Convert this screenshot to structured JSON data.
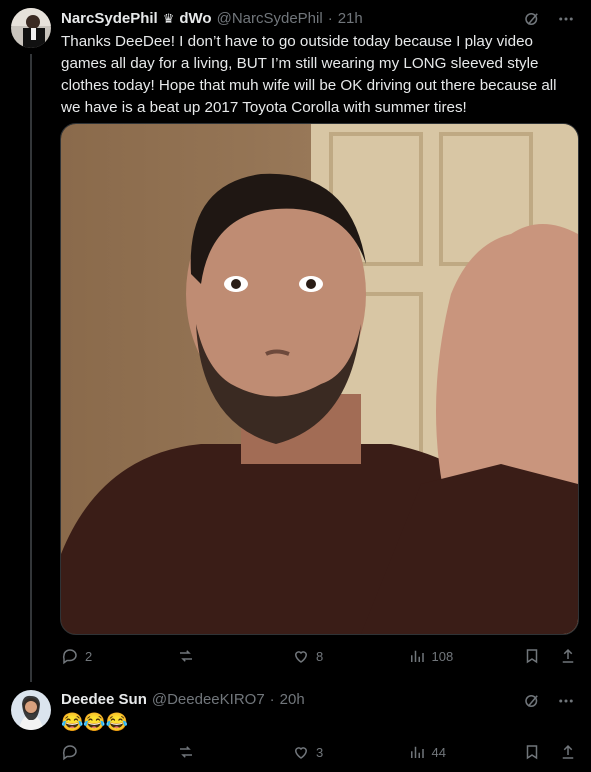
{
  "tweet1": {
    "name": "NarcSydePhil",
    "crown": "♛",
    "name_suffix": "dWo",
    "handle": "@NarcSydePhil",
    "dot": "·",
    "time": "21h",
    "text": "Thanks DeeDee! I don’t have to go outside today because I play video games all day for a living, BUT I’m still wearing my LONG sleeved style clothes today! Hope that muh wife will be OK driving out there because all we have is a beat up 2017 Toyota Corolla with summer tires!",
    "actions": {
      "reply_count": "2",
      "retweet_count": "",
      "like_count": "8",
      "views_count": "108"
    }
  },
  "tweet2": {
    "name": "Deedee Sun",
    "handle": "@DeedeeKIRO7",
    "dot": "·",
    "time": "20h",
    "text": "😂😂😂",
    "actions": {
      "reply_count": "",
      "retweet_count": "",
      "like_count": "3",
      "views_count": "44"
    }
  },
  "icons": {
    "grok": "grok-slash-icon",
    "more": "more-dots-icon",
    "reply": "reply-icon",
    "retweet": "retweet-icon",
    "like": "heart-icon",
    "views": "views-bar-icon",
    "bookmark": "bookmark-icon",
    "share": "share-icon"
  },
  "colors": {
    "background": "#000000",
    "text": "#e7e9ea",
    "muted": "#71767b",
    "border": "#2f3336"
  }
}
